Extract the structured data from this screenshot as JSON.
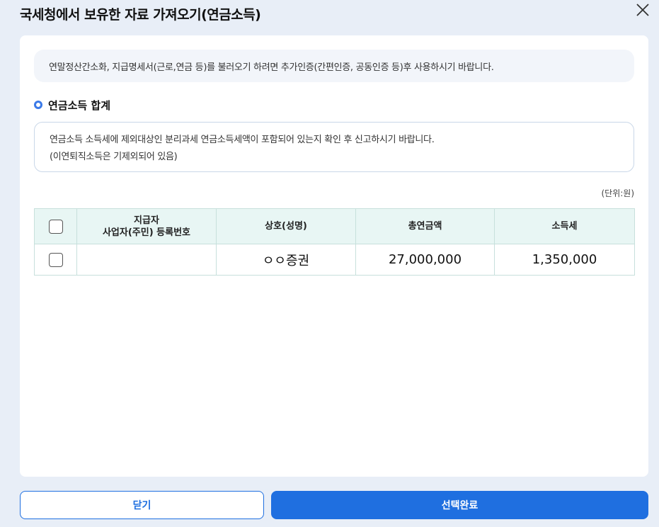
{
  "dialog": {
    "title": "국세청에서 보유한 자료 가져오기(연금소득)",
    "close_icon": "close-icon"
  },
  "notice": {
    "text": "연말정산간소화, 지급명세서(근로,연금 등)를 불러오기 하려면 추가인증(간편인증, 공동인증 등)후 사용하시기 바랍니다."
  },
  "section": {
    "title": "연금소득 합계",
    "info_line1": "연금소득 소득세에 제외대상인 분리과세 연금소득세액이 포함되어 있는지 확인 후 신고하시기 바랍니다.",
    "info_line2": "(이연퇴직소득은 기제외되어 있음)"
  },
  "table": {
    "unit": "(단위:원)",
    "headers": {
      "reg_line1": "지급자",
      "reg_line2": "사업자(주민) 등록번호",
      "name": "상호(성명)",
      "total": "총연금액",
      "tax": "소득세"
    },
    "rows": [
      {
        "checked": false,
        "reg_no": "",
        "name": "ㅇㅇ증권",
        "total": "27,000,000",
        "tax": "1,350,000"
      }
    ]
  },
  "buttons": {
    "close_label": "닫기",
    "confirm_label": "선택완료"
  },
  "colors": {
    "accent": "#1f6fe0",
    "header_bg": "#e8f6f4",
    "page_bg": "#e8eef7"
  }
}
